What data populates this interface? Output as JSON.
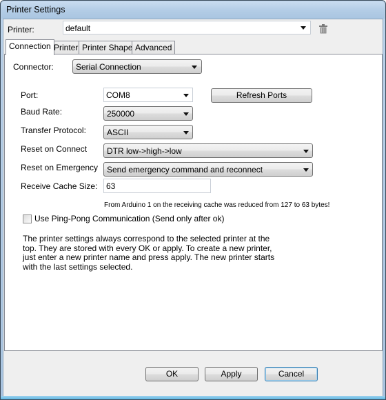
{
  "window": {
    "title": "Printer Settings"
  },
  "printer": {
    "label": "Printer:",
    "value": "default",
    "delete_icon": "trash-icon"
  },
  "tabs": [
    {
      "label": "Connection",
      "active": true
    },
    {
      "label": "Printer",
      "active": false
    },
    {
      "label": "Printer Shape",
      "active": false
    },
    {
      "label": "Advanced",
      "active": false
    }
  ],
  "connection": {
    "connector": {
      "label": "Connector:",
      "value": "Serial Connection"
    },
    "port": {
      "label": "Port:",
      "value": "COM8"
    },
    "refresh_ports_label": "Refresh Ports",
    "baud_rate": {
      "label": "Baud Rate:",
      "value": "250000"
    },
    "transfer_protocol": {
      "label": "Transfer Protocol:",
      "value": "ASCII"
    },
    "reset_on_connect": {
      "label": "Reset on Connect",
      "value": "DTR low->high->low"
    },
    "reset_on_emergency": {
      "label": "Reset on Emergency",
      "value": "Send emergency command and reconnect"
    },
    "receive_cache_size": {
      "label": "Receive Cache Size:",
      "value": "63"
    },
    "cache_note": "From Arduino 1 on the receiving cache was reduced from 127 to 63 bytes!",
    "ping_pong": {
      "label": "Use Ping-Pong Communication (Send only after ok)",
      "checked": false
    },
    "info_text": "The printer settings always correspond to the selected printer at the top. They are stored with every OK or apply. To create a new printer, just enter a new printer name and press apply. The new printer starts with the last settings selected."
  },
  "footer": {
    "ok_label": "OK",
    "apply_label": "Apply",
    "cancel_label": "Cancel"
  }
}
